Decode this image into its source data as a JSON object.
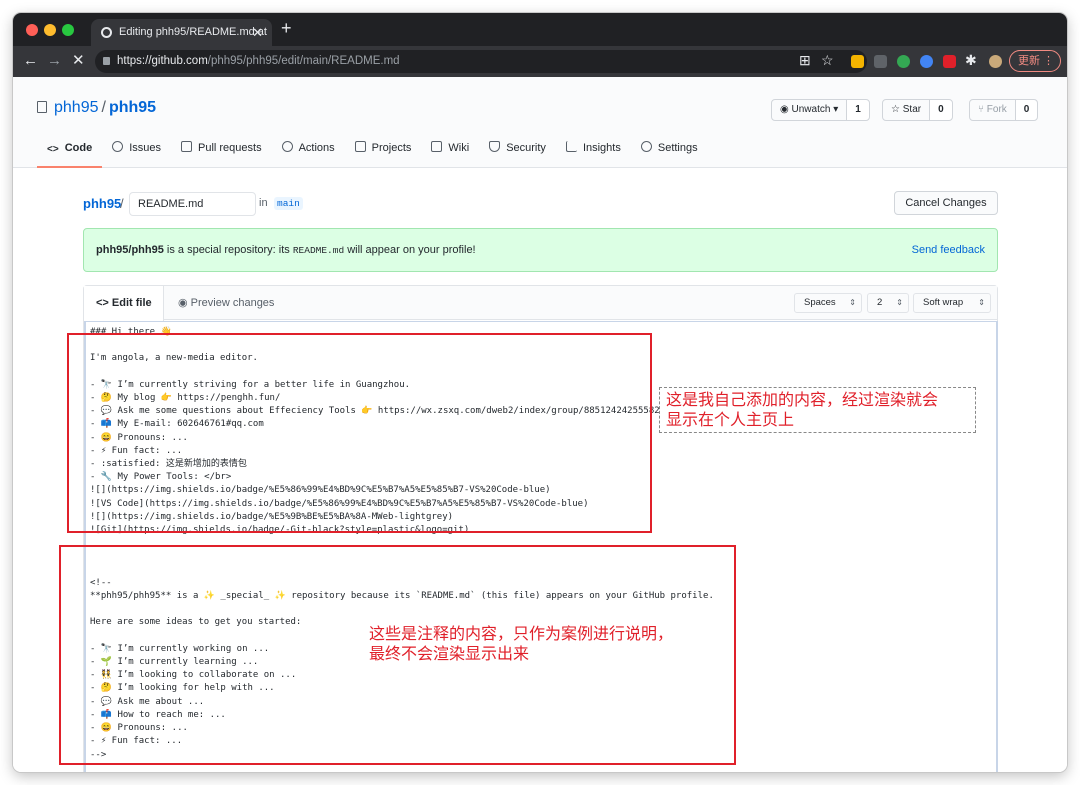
{
  "browser": {
    "tab_title": "Editing phh95/README.md at",
    "url_host": "https://github.com",
    "url_path": "/phh95/phh95/edit/main/README.md",
    "update_label": "更新"
  },
  "repo": {
    "owner": "phh95",
    "name": "phh95",
    "watch_label": "Unwatch",
    "watch_count": "1",
    "star_label": "Star",
    "star_count": "0",
    "fork_label": "Fork",
    "fork_count": "0"
  },
  "repo_tabs": [
    {
      "label": "Code",
      "icon": "code-icon"
    },
    {
      "label": "Issues",
      "icon": "issue-icon"
    },
    {
      "label": "Pull requests",
      "icon": "pull-request-icon"
    },
    {
      "label": "Actions",
      "icon": "play-icon"
    },
    {
      "label": "Projects",
      "icon": "project-icon"
    },
    {
      "label": "Wiki",
      "icon": "book-icon"
    },
    {
      "label": "Security",
      "icon": "shield-icon"
    },
    {
      "label": "Insights",
      "icon": "graph-icon"
    },
    {
      "label": "Settings",
      "icon": "gear-icon"
    }
  ],
  "edit": {
    "owner": "phh95",
    "filename": "README.md",
    "in_label": "in",
    "branch": "main",
    "cancel_label": "Cancel Changes"
  },
  "flash": {
    "repo": "phh95/phh95",
    "text_before": " is a special repository: its ",
    "code": "README.md",
    "text_after": " will appear on your profile!",
    "feedback": "Send feedback"
  },
  "editor": {
    "edit_tab": "Edit file",
    "preview_tab": "Preview changes",
    "indent_mode": "Spaces",
    "indent_size": "2",
    "wrap_mode": "Soft wrap",
    "code": "### Hi there 👋\n\nI'm angola, a new-media editor.\n\n- 🔭 I’m currently striving for a better life in Guangzhou.\n- 🤔 My blog 👉 https://penghh.fun/\n- 💬 Ask me some questions about Effeciency Tools 👉 https://wx.zsxq.com/dweb2/index/group/88512424255582\n- 📫 My E-mail: 602646761#qq.com\n- 😄 Pronouns: ...\n- ⚡ Fun fact: ...\n- :satisfied: 这是新增加的表情包\n- 🔧 My Power Tools: </br>\n![](https://img.shields.io/badge/%E5%86%99%E4%BD%9C%E5%B7%A5%E5%85%B7-VS%20Code-blue)\n![VS Code](https://img.shields.io/badge/%E5%86%99%E4%BD%9C%E5%B7%A5%E5%85%B7-VS%20Code-blue)\n![](https://img.shields.io/badge/%E5%9B%BE%E5%BA%8A-MWeb-lightgrey)\n![Git](https://img.shields.io/badge/-Git-black?style=plastic&logo=git)\n\n\n\n<!--\n**phh95/phh95** is a ✨ _special_ ✨ repository because its `README.md` (this file) appears on your GitHub profile.\n\nHere are some ideas to get you started:\n\n- 🔭 I’m currently working on ...\n- 🌱 I’m currently learning ...\n- 👯 I’m looking to collaborate on ...\n- 🤔 I’m looking for help with ...\n- 💬 Ask me about ...\n- 📫 How to reach me: ...\n- 😄 Pronouns: ...\n- ⚡ Fun fact: ...\n-->"
  },
  "annotations": {
    "note1_line1": "这是我自己添加的内容，经过渲染就会",
    "note1_line2": "显示在个人主页上",
    "note2_line1": "这些是注释的内容，只作为案例进行说明，",
    "note2_line2": "最终不会渲染显示出来",
    "color": "#e0202a"
  }
}
